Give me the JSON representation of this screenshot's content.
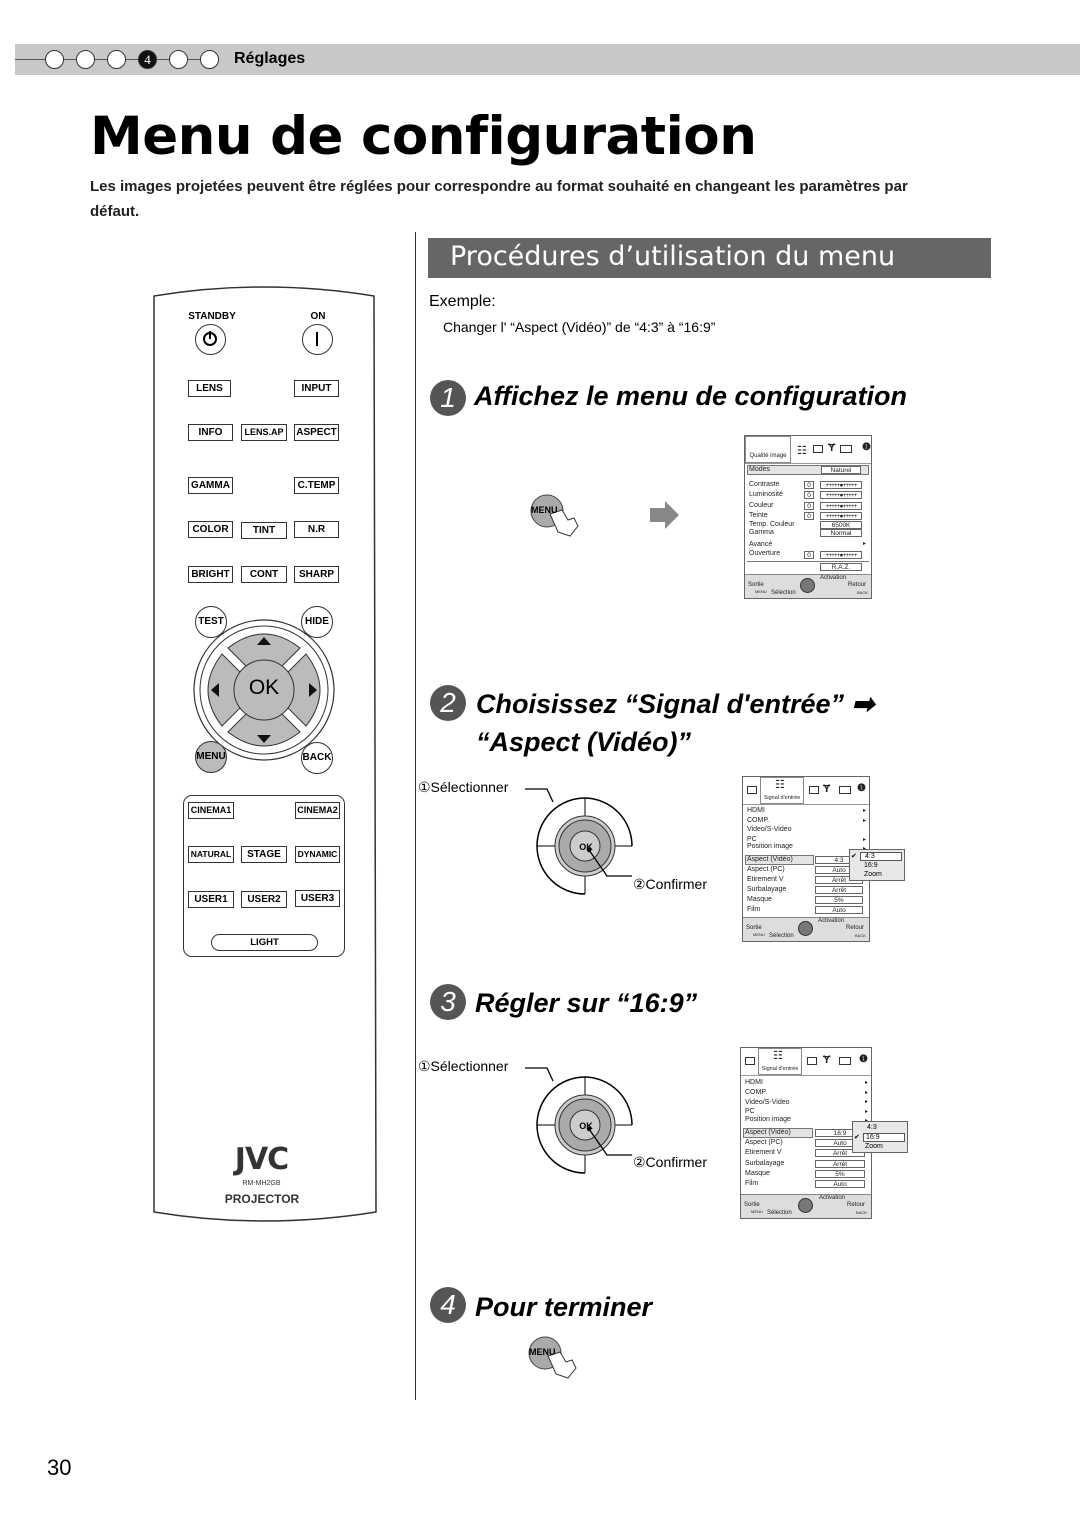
{
  "header": {
    "steps": [
      "",
      "",
      "",
      "4",
      "",
      ""
    ],
    "active_step": 4,
    "label": "Réglages"
  },
  "title": "Menu de configuration",
  "intro": "Les images projetées peuvent être réglées pour correspondre au format souhaité en changeant les paramètres par défaut.",
  "section": {
    "title": "Procédures d’utilisation du menu",
    "example_label": "Exemple:",
    "example_text": "Changer l' “Aspect (Vidéo)” de “4:3” à “16:9”"
  },
  "steps": [
    {
      "num": "1",
      "title": "Affichez le menu de configuration"
    },
    {
      "num": "2",
      "title_line1": "Choisissez “Signal d'entrée” ➡",
      "title_line2": "“Aspect (Vidéo)”"
    },
    {
      "num": "3",
      "title": "Régler sur “16:9”"
    },
    {
      "num": "4",
      "title": "Pour terminer"
    }
  ],
  "callouts": {
    "select": "①Sélectionner",
    "confirm": "②Confirmer",
    "menu_btn": "MENU",
    "ok": "OK"
  },
  "remote": {
    "standby": "STANDBY",
    "on": "ON",
    "rows": [
      [
        "LENS",
        "",
        "INPUT"
      ],
      [
        "INFO",
        "LENS.AP",
        "ASPECT"
      ],
      [
        "GAMMA",
        "",
        "C.TEMP"
      ],
      [
        "COLOR",
        "TINT",
        "N.R"
      ],
      [
        "BRIGHT",
        "CONT",
        "SHARP"
      ]
    ],
    "test": "TEST",
    "hide": "HIDE",
    "ok": "OK",
    "menu": "MENU",
    "back": "BACK",
    "modes": [
      [
        "CINEMA1",
        "",
        "CINEMA2"
      ],
      [
        "NATURAL",
        "STAGE",
        "DYNAMIC"
      ],
      [
        "USER1",
        "USER2",
        "USER3"
      ]
    ],
    "light": "LIGHT",
    "brand": "JVC",
    "model": "RM-MH2GB",
    "product": "PROJECTOR"
  },
  "osd1": {
    "tab": "Qualité image",
    "modes_label": "Modes",
    "modes_value": "Naturel",
    "items": [
      {
        "label": "Contraste",
        "num": "0",
        "slider": true
      },
      {
        "label": "Luminosité",
        "num": "0",
        "slider": true
      },
      {
        "label": "Couleur",
        "num": "0",
        "slider": true
      },
      {
        "label": "Teinte",
        "num": "0",
        "slider": true
      },
      {
        "label": "Temp. Couleur",
        "value": "6500K"
      },
      {
        "label": "Gamma",
        "value": "Normal"
      },
      {
        "label": "Avancé",
        "arrow": true
      },
      {
        "label": "Ouverture",
        "num": "0",
        "slider": true
      }
    ],
    "reset": "R.A.Z.",
    "footer": {
      "exit": "Sortie",
      "exit_key": "MENU",
      "select": "Sélection",
      "activate": "Activation",
      "back": "Retour",
      "back_key": "BACK"
    }
  },
  "osd2": {
    "tab": "Signal d'entrée",
    "submenus": [
      "HDMI",
      "COMP.",
      "Video/S-Video",
      "PC",
      "Position image"
    ],
    "items": [
      {
        "label": "Aspect (Vidéo)",
        "value": "4:3"
      },
      {
        "label": "Aspect (PC)",
        "value": "Auto"
      },
      {
        "label": "Etirement V",
        "value": "Arrêt"
      },
      {
        "label": "Surbalayage",
        "value": "Arrêt"
      },
      {
        "label": "Masque",
        "value": "5%"
      },
      {
        "label": "Film",
        "value": "Auto"
      }
    ],
    "popup": [
      "4:3",
      "16:9",
      "Zoom"
    ],
    "popup_selected": "4:3"
  },
  "osd3": {
    "tab": "Signal d'entrée",
    "submenus": [
      "HDMI",
      "COMP.",
      "Video/S-Video",
      "PC",
      "Position image"
    ],
    "items": [
      {
        "label": "Aspect (Vidéo)",
        "value": "16:9"
      },
      {
        "label": "Aspect (PC)",
        "value": "Auto"
      },
      {
        "label": "Etirement V",
        "value": "Arrêt"
      },
      {
        "label": "Surbalayage",
        "value": "Arrêt"
      },
      {
        "label": "Masque",
        "value": "5%"
      },
      {
        "label": "Film",
        "value": "Auto"
      }
    ],
    "popup": [
      "4:3",
      "16:9",
      "Zoom"
    ],
    "popup_selected": "16:9"
  },
  "page_number": "30"
}
